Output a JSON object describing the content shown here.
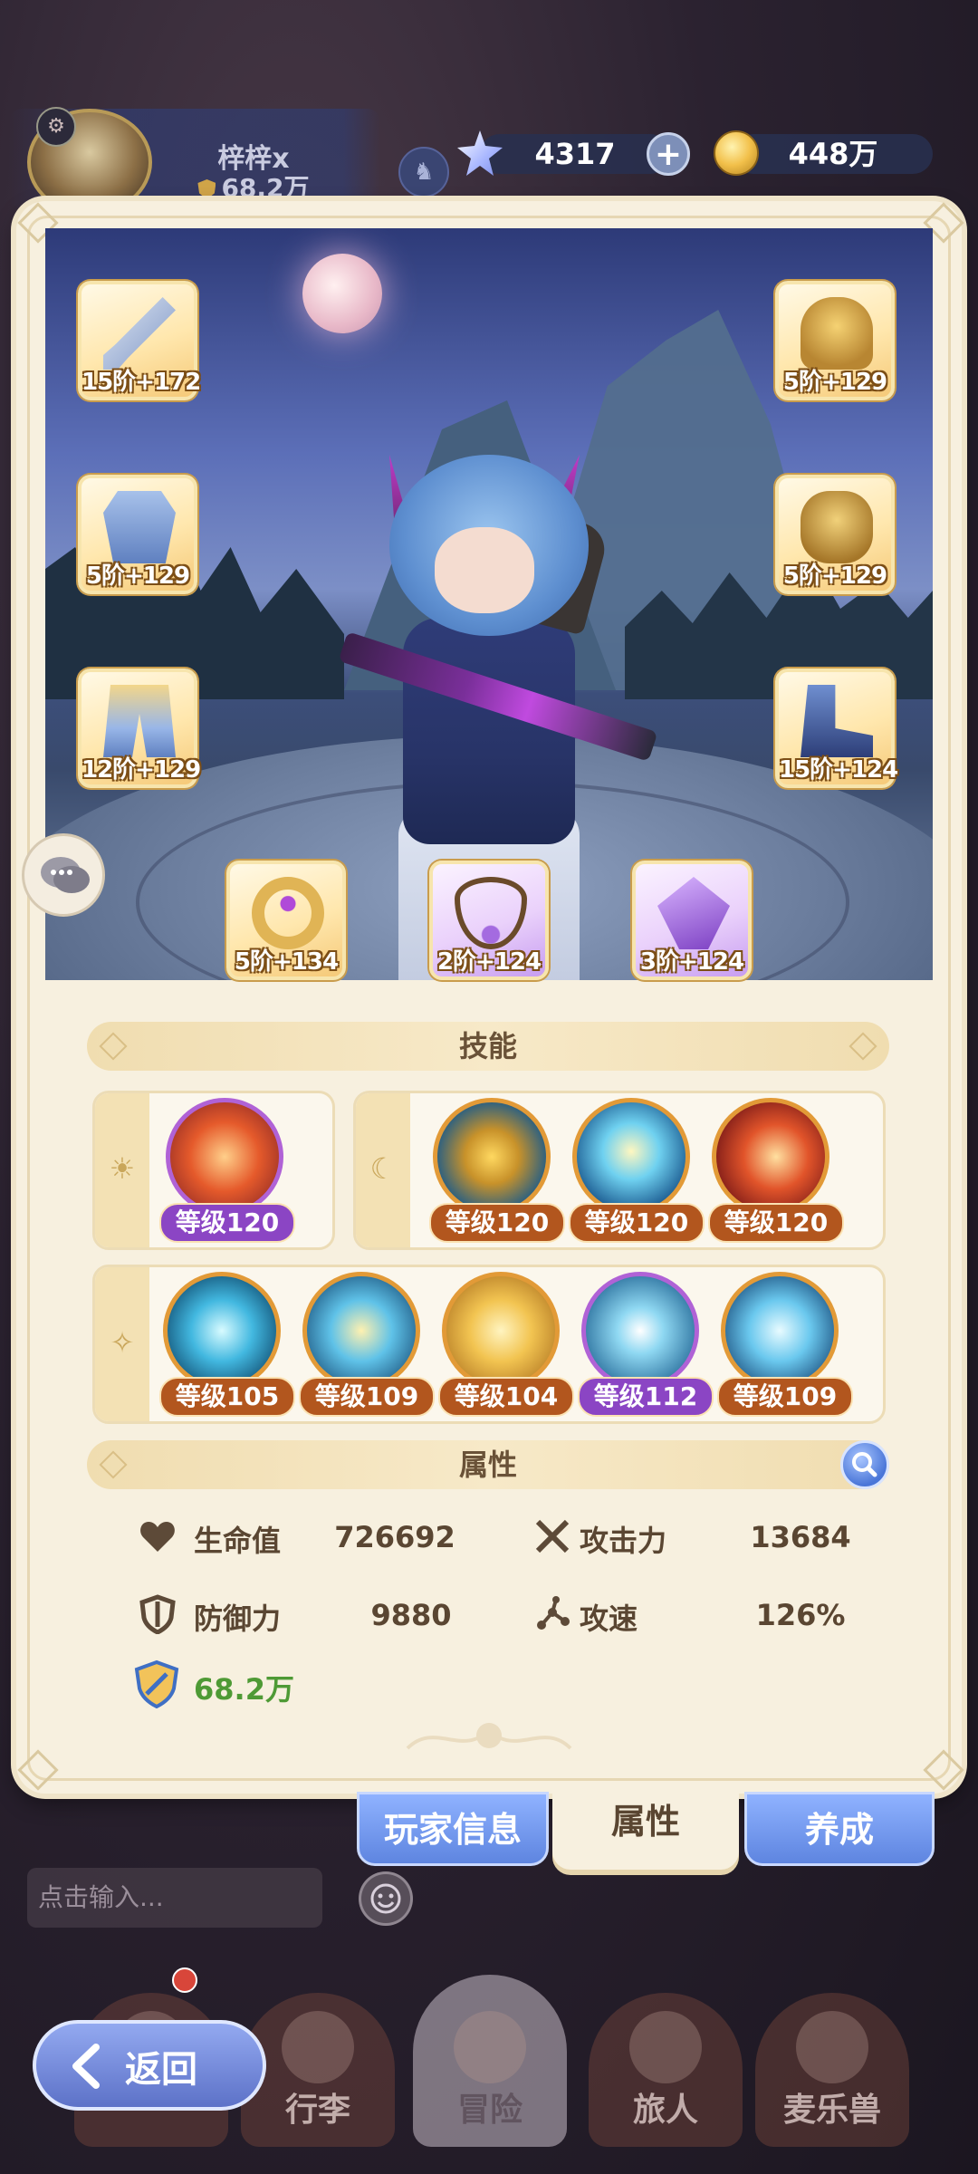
{
  "player": {
    "name": "梓梓x",
    "power": "68.2万"
  },
  "resources": {
    "gems": "4317",
    "coins": "448万"
  },
  "equipment": [
    {
      "slot": "weapon",
      "label": "15阶+172",
      "rarity": "gold"
    },
    {
      "slot": "helmet",
      "label": "5阶+129",
      "rarity": "gold"
    },
    {
      "slot": "armor",
      "label": "5阶+129",
      "rarity": "gold"
    },
    {
      "slot": "gloves",
      "label": "5阶+129",
      "rarity": "gold"
    },
    {
      "slot": "pants",
      "label": "12阶+129",
      "rarity": "gold"
    },
    {
      "slot": "boots",
      "label": "15阶+124",
      "rarity": "gold"
    },
    {
      "slot": "ring",
      "label": "5阶+134",
      "rarity": "gold"
    },
    {
      "slot": "necklace",
      "label": "2阶+124",
      "rarity": "purple"
    },
    {
      "slot": "charm",
      "label": "3阶+124",
      "rarity": "purple"
    }
  ],
  "skills": {
    "title": "技能",
    "sun_group": [
      {
        "level": "等级120",
        "rarity": "purple",
        "icon": "fire-portal-skill-icon"
      }
    ],
    "moon_group": [
      {
        "level": "等级120",
        "rarity": "gold",
        "icon": "golden-armor-skill-icon"
      },
      {
        "level": "等级120",
        "rarity": "gold",
        "icon": "radiant-guardian-skill-icon"
      },
      {
        "level": "等级120",
        "rarity": "gold",
        "icon": "flame-slash-skill-icon"
      }
    ],
    "star_group": [
      {
        "level": "等级105",
        "rarity": "gold",
        "icon": "blue-flame-skill-icon"
      },
      {
        "level": "等级109",
        "rarity": "gold",
        "icon": "wing-burst-skill-icon"
      },
      {
        "level": "等级104",
        "rarity": "gold",
        "icon": "eye-shield-skill-icon"
      },
      {
        "level": "等级112",
        "rarity": "purple",
        "icon": "vortex-skill-icon"
      },
      {
        "level": "等级109",
        "rarity": "gold",
        "icon": "ice-sword-skill-icon"
      }
    ]
  },
  "attributes": {
    "title": "属性",
    "hp_label": "生命值",
    "hp_value": "726692",
    "atk_label": "攻击力",
    "atk_value": "13684",
    "def_label": "防御力",
    "def_value": "9880",
    "spd_label": "攻速",
    "spd_value": "126%",
    "power_value": "68.2万"
  },
  "tabs": {
    "player_info": "玩家信息",
    "attributes": "属性",
    "develop": "养成"
  },
  "chat": {
    "placeholder": "点击输入..."
  },
  "nav": {
    "back": "返回",
    "bag": "行李",
    "adventure": "冒险",
    "traveler": "旅人",
    "pets": "麦乐兽"
  },
  "colors": {
    "panel": "#f7f0df",
    "accent_gold": "#e29a37",
    "accent_purple": "#b062d6",
    "power_green": "#4e9a35",
    "tab_blue": "#5e85e0"
  }
}
